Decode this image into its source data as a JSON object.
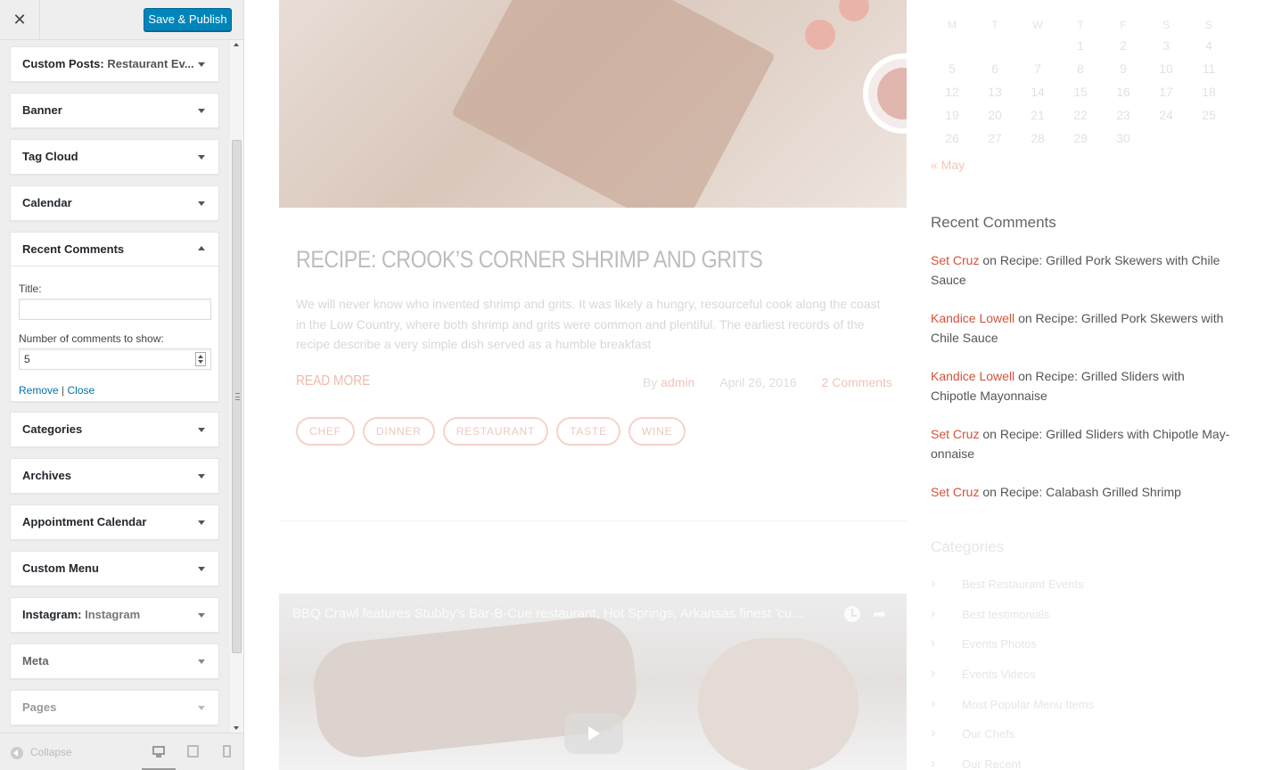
{
  "customizer": {
    "close_icon": "✕",
    "publish_label": "Save & Publish",
    "widgets": [
      {
        "title": "Custom Posts:",
        "subtitle": "Restaurant Ev..."
      },
      {
        "title": "Banner",
        "subtitle": ""
      },
      {
        "title": "Tag Cloud",
        "subtitle": ""
      },
      {
        "title": "Calendar",
        "subtitle": ""
      },
      {
        "title": "Recent Comments",
        "subtitle": "",
        "expanded": true
      },
      {
        "title": "Categories",
        "subtitle": ""
      },
      {
        "title": "Archives",
        "subtitle": ""
      },
      {
        "title": "Appointment Calendar",
        "subtitle": ""
      },
      {
        "title": "Custom Menu",
        "subtitle": ""
      },
      {
        "title": "Instagram:",
        "subtitle": "Instagram"
      },
      {
        "title": "Meta",
        "subtitle": ""
      },
      {
        "title": "Pages",
        "subtitle": ""
      }
    ],
    "recent_comments_form": {
      "title_label": "Title:",
      "title_value": "",
      "count_label": "Number of comments to show:",
      "count_value": "5",
      "remove_label": "Remove",
      "separator": "|",
      "close_label": "Close"
    },
    "footer": {
      "collapse_label": "Collapse",
      "devices": [
        "desktop-icon",
        "tablet-icon",
        "mobile-icon"
      ],
      "active_device": "desktop"
    }
  },
  "preview": {
    "post": {
      "title": "RECIPE: CROOK’S CORNER SHRIMP AND GRITS",
      "excerpt": "We will never know who invented shrimp and grits. It was likely a hungry, resourceful cook along the coast in the Low Country, where both shrimp and grits were common and plentiful. The earliest records of the recipe describe a very simple dish served as a humble breakfast",
      "read_more": "READ MORE",
      "meta": {
        "by": "By",
        "author": "admin",
        "date": "April 26, 2016",
        "comments": "2 Comments"
      },
      "tags": [
        "CHEF",
        "DINNER",
        "RESTAURANT",
        "TASTE",
        "WINE"
      ]
    },
    "video": {
      "title": "BBQ Crawl features Stubby's Bar-B-Cue restaurant, Hot Springs, Arkansas finest 'cu...",
      "share_icon": "➦"
    },
    "calendar": {
      "weekdays": [
        "M",
        "T",
        "W",
        "T",
        "F",
        "S",
        "S"
      ],
      "weeks": [
        [
          "",
          "",
          "",
          "1",
          "2",
          "3",
          "4"
        ],
        [
          "5",
          "6",
          "7",
          "8",
          "9",
          "10",
          "11"
        ],
        [
          "12",
          "13",
          "14",
          "15",
          "16",
          "17",
          "18"
        ],
        [
          "19",
          "20",
          "21",
          "22",
          "23",
          "24",
          "25"
        ],
        [
          "26",
          "27",
          "28",
          "29",
          "30",
          "",
          ""
        ]
      ],
      "prev_link": "« May"
    },
    "recent_comments": {
      "title": "Recent Comments",
      "items": [
        {
          "author": "Set Cruz",
          "on": "on",
          "post": "Recipe: Grilled Pork Skewers with Chile Sauce"
        },
        {
          "author": "Kandice Lowell",
          "on": "on",
          "post": "Recipe: Grilled Pork Skewers with Chile Sauce"
        },
        {
          "author": "Kandice Lowell",
          "on": "on",
          "post": "Recipe: Grilled Sliders with Chipotle Mayonnaise"
        },
        {
          "author": "Set Cruz",
          "on": "on",
          "post": "Recipe: Grilled Sliders with Chipotle May­onnaise"
        },
        {
          "author": "Set Cruz",
          "on": "on",
          "post": "Recipe: Calabash Grilled Shrimp"
        }
      ]
    },
    "categories": {
      "title": "Categories",
      "items": [
        "Best Restaurant Events",
        "Best testimonials",
        "Events Photos",
        "Events Videos",
        "Most Popular Menu Items",
        "Our Chefs",
        "Our Recent"
      ]
    }
  }
}
